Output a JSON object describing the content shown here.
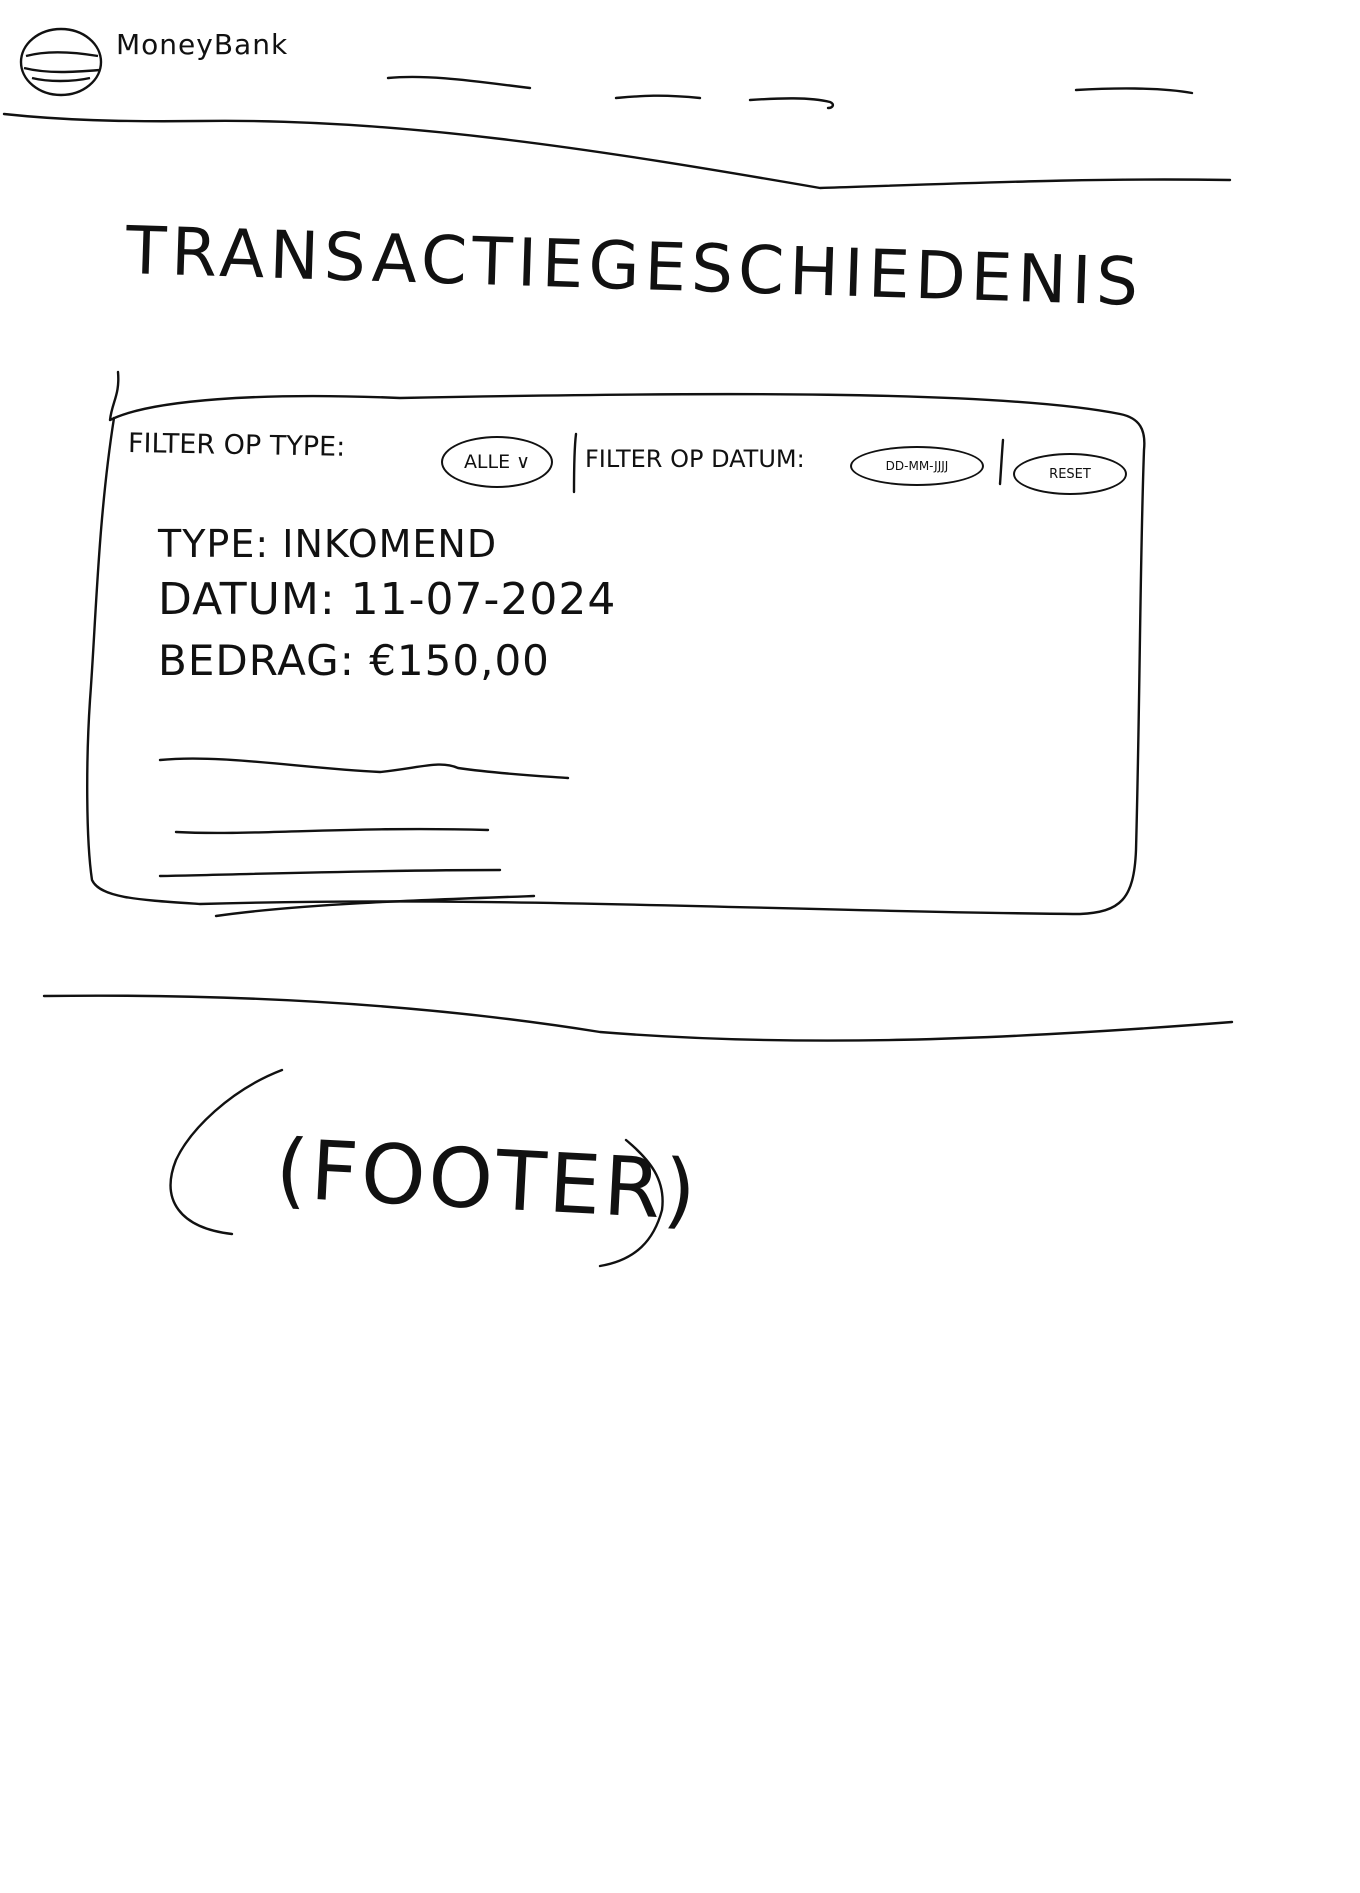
{
  "header": {
    "brand": "MoneyBank",
    "logo_icon": "bank-coin-icon",
    "nav_links": [
      {
        "icon": "scribble-link",
        "label": ""
      },
      {
        "icon": "scribble-link",
        "label": ""
      },
      {
        "icon": "scribble-link",
        "label": ""
      },
      {
        "icon": "scribble-link",
        "label": ""
      }
    ]
  },
  "main": {
    "title": "TRANSACTIEGESCHIEDENIS",
    "filters": {
      "type_label": "FILTER OP TYPE:",
      "type_selected": "ALLE ∨",
      "type_options": [
        "ALLE ∨"
      ],
      "date_label": "FILTER OP DATUM:",
      "date_placeholder": "DD-MM-JJJJ",
      "reset_label": "RESET"
    },
    "transaction": {
      "type_text": "TYPE: INKOMEND",
      "date_text": "DATUM: 11-07-2024",
      "amount_text": "BEDRAG: €150,00"
    },
    "placeholder_rows": 4
  },
  "footer": {
    "label": "(FOOTER)"
  },
  "colors": {
    "ink": "#111111",
    "paper": "#ffffff"
  }
}
